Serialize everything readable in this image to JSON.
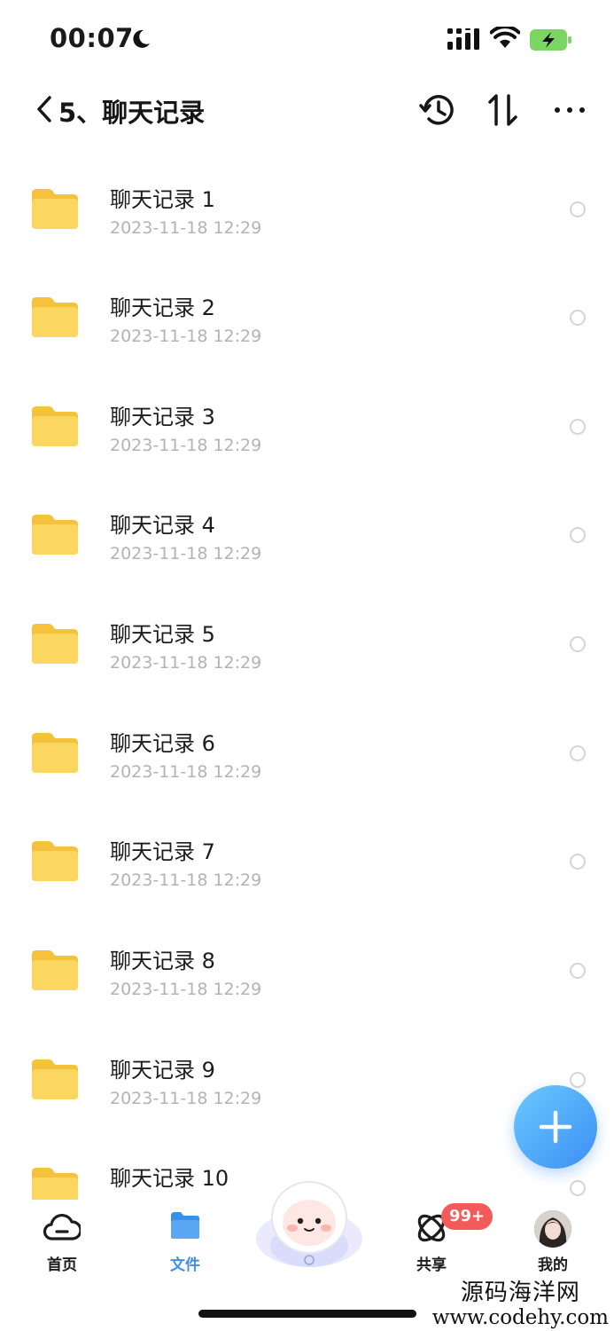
{
  "status_bar": {
    "time": "00:07"
  },
  "header": {
    "title": "5、聊天记录"
  },
  "files": [
    {
      "name": "聊天记录 1",
      "date": "2023-11-18 12:29"
    },
    {
      "name": "聊天记录 2",
      "date": "2023-11-18 12:29"
    },
    {
      "name": "聊天记录 3",
      "date": "2023-11-18 12:29"
    },
    {
      "name": "聊天记录 4",
      "date": "2023-11-18 12:29"
    },
    {
      "name": "聊天记录 5",
      "date": "2023-11-18 12:29"
    },
    {
      "name": "聊天记录 6",
      "date": "2023-11-18 12:29"
    },
    {
      "name": "聊天记录 7",
      "date": "2023-11-18 12:29"
    },
    {
      "name": "聊天记录 8",
      "date": "2023-11-18 12:29"
    },
    {
      "name": "聊天记录 9",
      "date": "2023-11-18 12:29"
    },
    {
      "name": "聊天记录 10",
      "date": ""
    }
  ],
  "tab_bar": {
    "home": "首页",
    "files": "文件",
    "share": "共享",
    "share_badge": "99+",
    "me": "我的",
    "active_tab": "files"
  },
  "watermark": {
    "cn": "源码海洋网",
    "url": "www.codehy.com"
  },
  "colors": {
    "accent": "#3a8fe8",
    "folder": "#f9cf4a",
    "badge": "#f35b5b",
    "fab_start": "#6cc9ff",
    "fab_end": "#3b8ff3"
  },
  "icons": [
    "moon-icon",
    "signal-icon",
    "wifi-icon",
    "battery-charging-icon",
    "back-icon",
    "history-icon",
    "sort-icon",
    "more-icon",
    "folder-icon",
    "plus-icon",
    "home-icon",
    "files-icon",
    "mascot-icon",
    "share-icon",
    "avatar"
  ]
}
